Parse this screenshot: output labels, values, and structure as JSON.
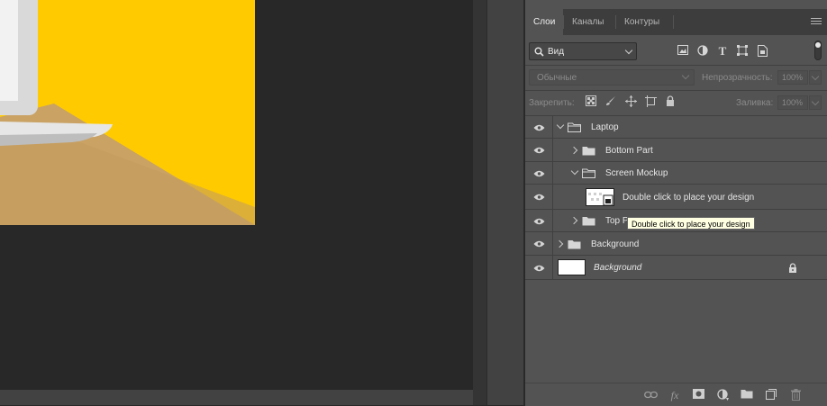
{
  "panel": {
    "tabs": [
      {
        "label": "Слои",
        "active": true
      },
      {
        "label": "Каналы",
        "active": false
      },
      {
        "label": "Контуры",
        "active": false
      }
    ],
    "menu_icon": "hamburger-icon"
  },
  "filter": {
    "label": "Вид",
    "icons": [
      "image-filter-icon",
      "adjustment-filter-icon",
      "type-filter-icon",
      "shape-filter-icon",
      "smart-object-filter-icon"
    ]
  },
  "blend": {
    "mode": "Обычные",
    "opacity_label": "Непрозрачность:",
    "opacity_value": "100%"
  },
  "lock": {
    "label": "Закрепить:",
    "icons": [
      "lock-transparent-icon",
      "lock-paint-icon",
      "lock-position-icon",
      "lock-artboard-icon",
      "lock-all-icon"
    ],
    "fill_label": "Заливка:",
    "fill_value": "100%"
  },
  "layers": [
    {
      "name": "Laptop",
      "type": "group",
      "expanded": true
    },
    {
      "name": "Bottom Part",
      "type": "group",
      "expanded": false
    },
    {
      "name": "Screen Mockup",
      "type": "group",
      "expanded": true
    },
    {
      "name": "Double click to place your design",
      "type": "smart-object"
    },
    {
      "name": "Top P",
      "type": "group",
      "expanded": false
    },
    {
      "name": "Background",
      "type": "group",
      "expanded": false
    },
    {
      "name": "Background",
      "type": "locked-layer",
      "locked": true
    }
  ],
  "tooltip": "Double click to place your design",
  "bottom_icons": [
    "link-layers-icon",
    "fx-icon",
    "add-mask-icon",
    "adjustment-layer-icon",
    "new-group-icon",
    "new-layer-icon",
    "trash-icon"
  ],
  "colors": {
    "canvas_bg": "#282828",
    "artboard_yellow": "#ffcb00",
    "desk_tan": "#c9a264",
    "panel_bg": "#535353",
    "tooltip_bg": "#ffffe1"
  }
}
